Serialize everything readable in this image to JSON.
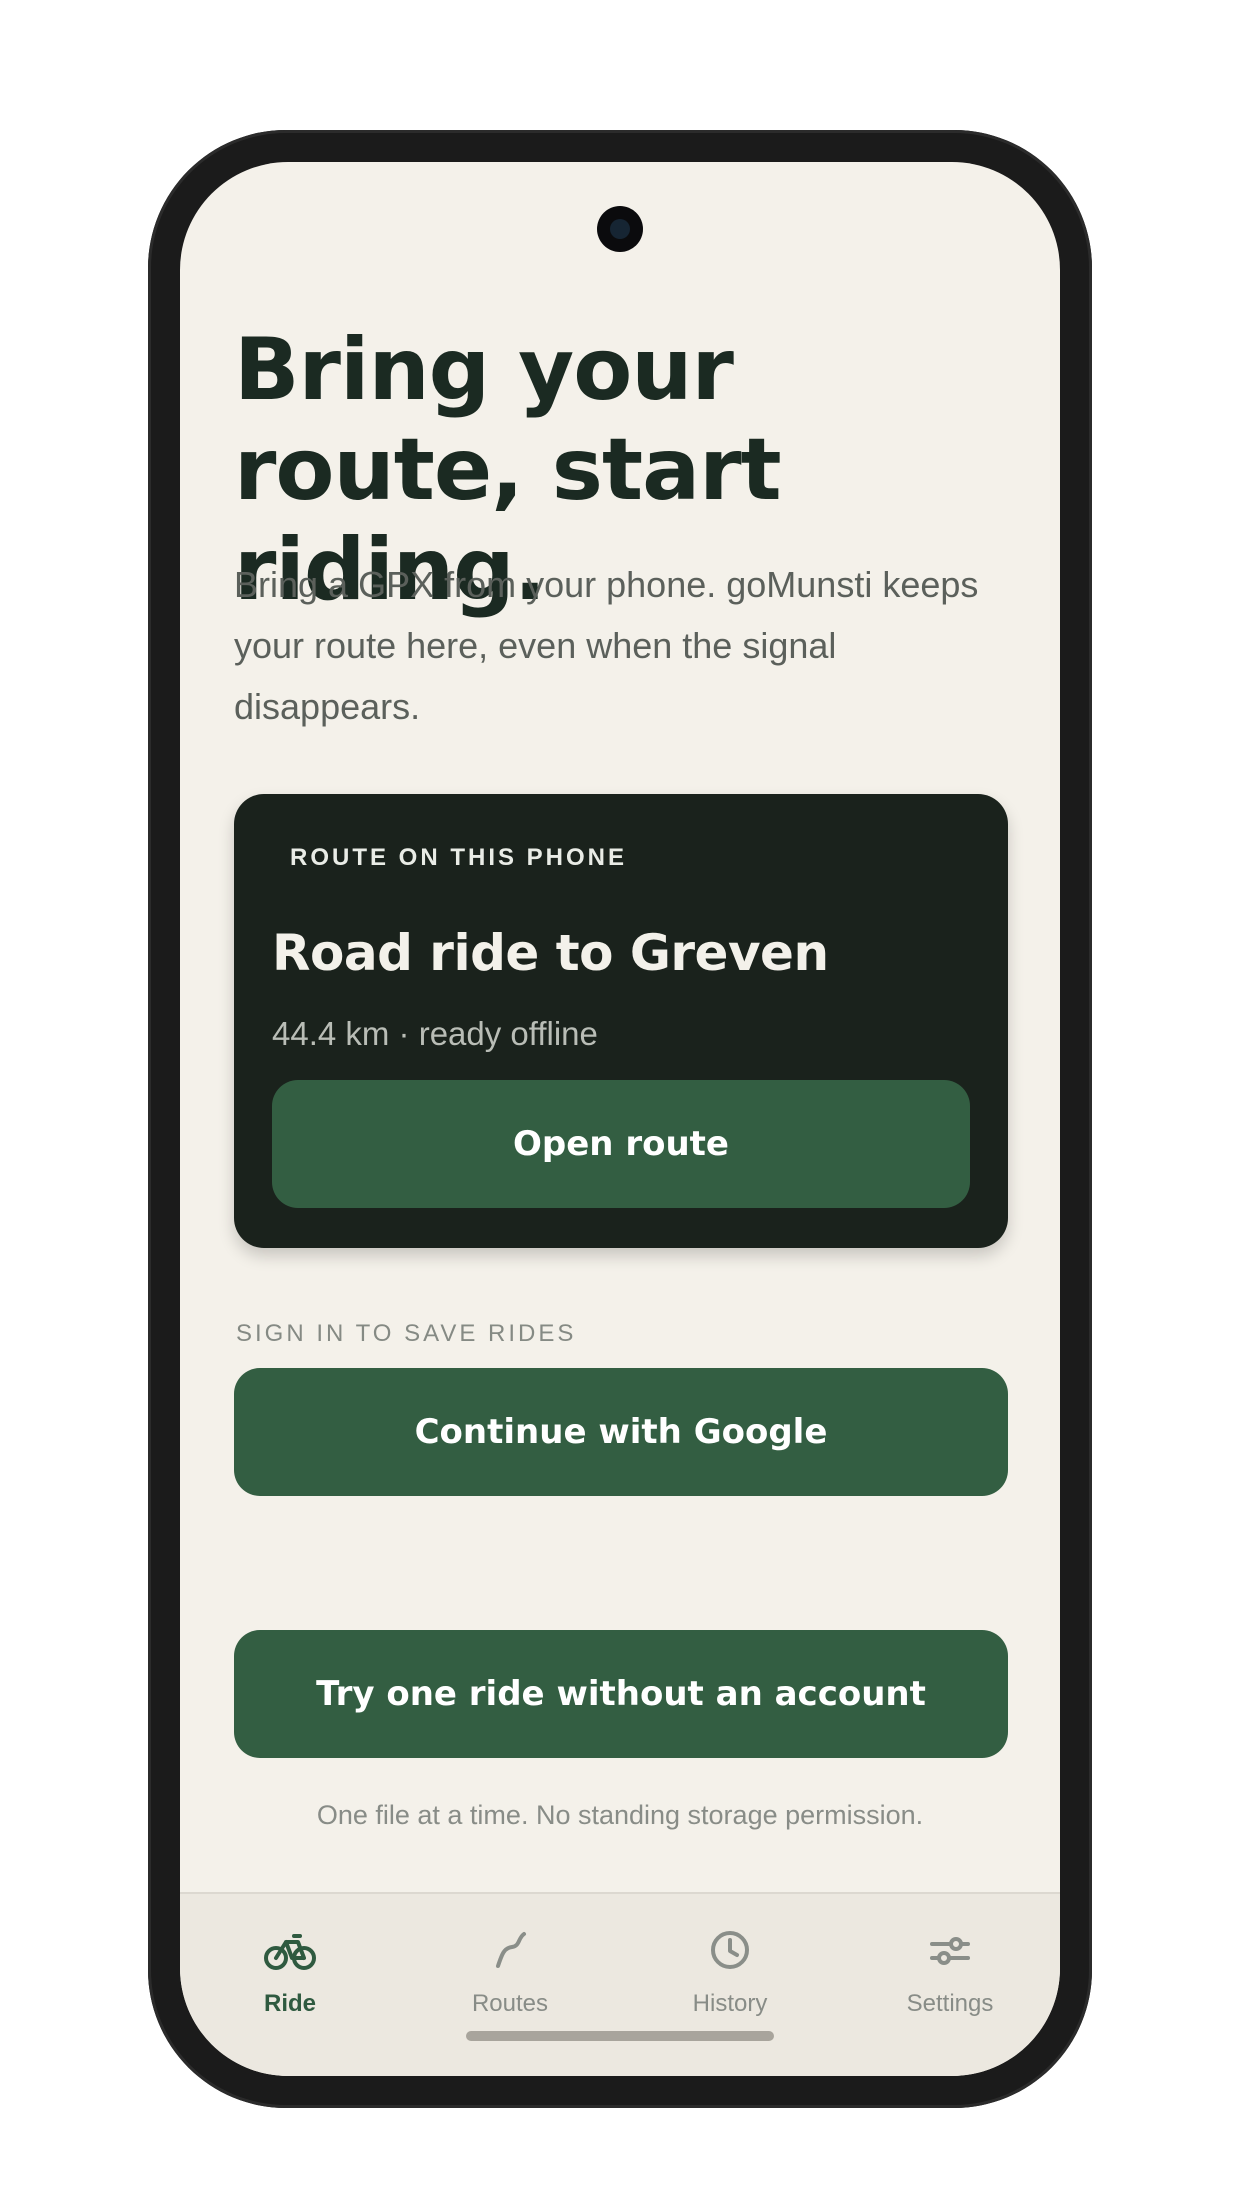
{
  "hero": {
    "headline": "Bring your route, start riding.",
    "intro": "Bring a GPX from your phone. goMunsti keeps your route here, even when the signal disappears."
  },
  "route_card": {
    "eyebrow": "ROUTE ON THIS PHONE",
    "title": "Road ride to Greven",
    "meta": "44.4 km · ready offline",
    "open_label": "Open route"
  },
  "signin": {
    "section_label": "SIGN IN TO SAVE RIDES",
    "google_label": "Continue with Google",
    "guest_label": "Try one ride without an account",
    "footnote": "One file at a time. No standing storage permission."
  },
  "tabbar": {
    "tabs": [
      {
        "label": "Ride",
        "icon": "bicycle-icon",
        "active": true
      },
      {
        "label": "Routes",
        "icon": "route-icon",
        "active": false
      },
      {
        "label": "History",
        "icon": "clock-icon",
        "active": false
      },
      {
        "label": "Settings",
        "icon": "sliders-icon",
        "active": false
      }
    ]
  },
  "colors": {
    "background": "#f4f1ea",
    "card": "#1a221c",
    "accent_green": "#335e42",
    "text_dark": "#1b2a22"
  }
}
